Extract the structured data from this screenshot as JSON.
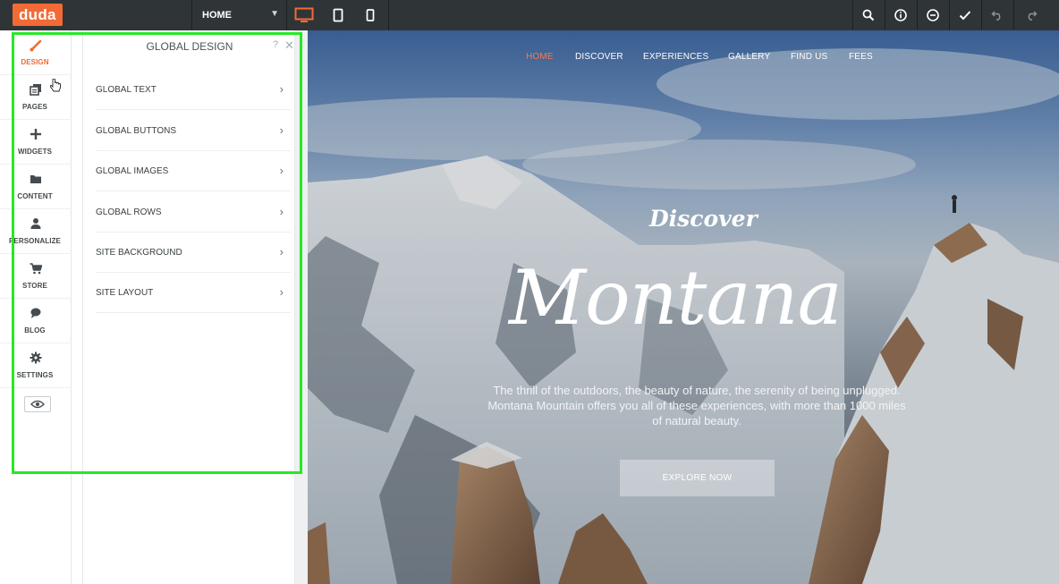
{
  "app": {
    "logo": "duda"
  },
  "toolbar": {
    "page_selector": {
      "value": "HOME"
    },
    "devices": [
      "desktop-icon",
      "tablet-icon",
      "mobile-icon"
    ],
    "actions": [
      "search-icon",
      "info-icon",
      "comment-icon",
      "check-icon",
      "undo-icon",
      "redo-icon"
    ]
  },
  "sidebar": {
    "items": [
      {
        "label": "DESIGN",
        "icon": "brush-icon",
        "active": true
      },
      {
        "label": "PAGES",
        "icon": "pages-icon"
      },
      {
        "label": "WIDGETS",
        "icon": "plus-icon"
      },
      {
        "label": "CONTENT",
        "icon": "folder-icon"
      },
      {
        "label": "PERSONALIZE",
        "icon": "person-icon"
      },
      {
        "label": "STORE",
        "icon": "cart-icon"
      },
      {
        "label": "BLOG",
        "icon": "chat-icon"
      },
      {
        "label": "SETTINGS",
        "icon": "gear-icon"
      }
    ],
    "preview_icon": "eye-icon"
  },
  "panel": {
    "title": "GLOBAL DESIGN",
    "help": "?",
    "close": "✕",
    "items": [
      {
        "label": "GLOBAL TEXT",
        "chevron": "›"
      },
      {
        "label": "GLOBAL BUTTONS",
        "chevron": "›"
      },
      {
        "label": "GLOBAL IMAGES",
        "chevron": "›"
      },
      {
        "label": "GLOBAL ROWS",
        "chevron": "›"
      },
      {
        "label": "SITE BACKGROUND",
        "chevron": "›"
      },
      {
        "label": "SITE LAYOUT",
        "chevron": "›"
      }
    ]
  },
  "site": {
    "nav": [
      "HOME",
      "DISCOVER",
      "EXPERIENCES",
      "GALLERY",
      "FIND US",
      "FEES"
    ],
    "discover": "Discover",
    "title": "Montana",
    "text": "The thrill of the outdoors, the beauty of nature, the serenity of being unplugged. Montana Mountain offers you all of these experiences, with more than 1000 miles of natural beauty.",
    "button": "EXPLORE NOW"
  },
  "colors": {
    "brand": "#f26a36",
    "topbar": "#2f3537",
    "highlight": "#27e827",
    "active_nav": "#f47a50"
  }
}
